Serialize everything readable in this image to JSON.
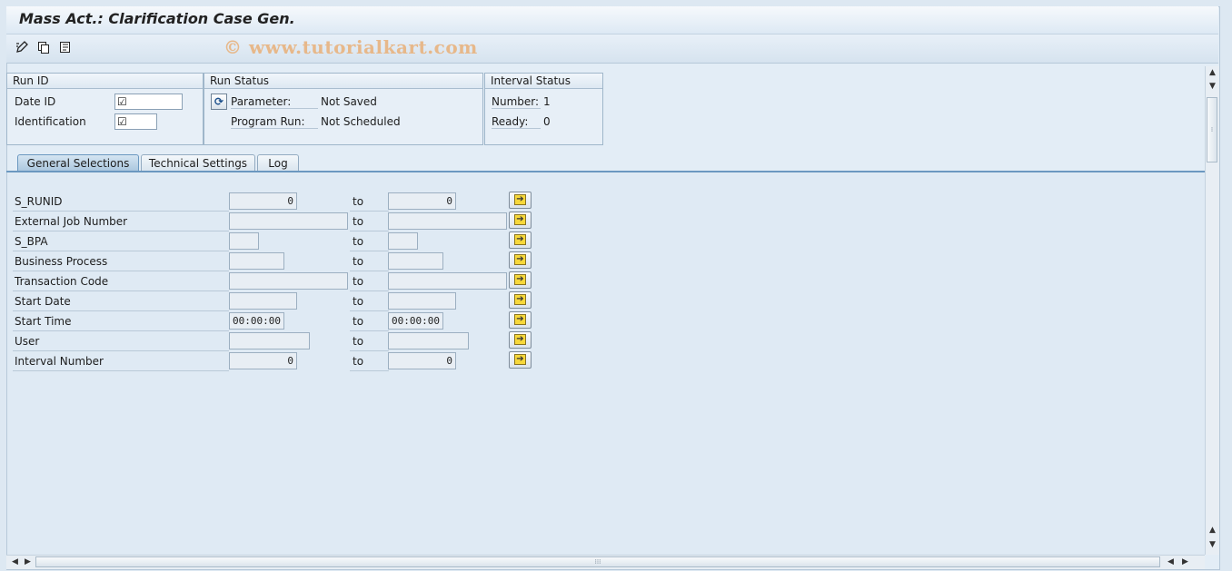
{
  "window": {
    "title": "Mass Act.: Clarification Case Gen."
  },
  "watermark": "© www.tutorialkart.com",
  "toolbar": {
    "icons": [
      "edit-pencil-icon",
      "copy-icon",
      "list-icon"
    ]
  },
  "run_id": {
    "header": "Run ID",
    "date_id_label": "Date ID",
    "identification_label": "Identification",
    "required_mark": "☑"
  },
  "run_status": {
    "header": "Run Status",
    "parameter_label": "Parameter:",
    "parameter_value": "Not Saved",
    "program_run_label": "Program Run:",
    "program_run_value": "Not Scheduled"
  },
  "interval_status": {
    "header": "Interval Status",
    "number_label": "Number:",
    "number_value": "1",
    "ready_label": "Ready:",
    "ready_value": "0"
  },
  "tabs": [
    {
      "label": "General Selections",
      "active": true
    },
    {
      "label": "Technical Settings",
      "active": false
    },
    {
      "label": "Log",
      "active": false
    }
  ],
  "selection": {
    "to_label": "to",
    "rows": [
      {
        "label": "S_RUNID",
        "from": "0",
        "to": "0"
      },
      {
        "label": "External Job Number",
        "from": "",
        "to": ""
      },
      {
        "label": "S_BPA",
        "from": "",
        "to": ""
      },
      {
        "label": "Business Process",
        "from": "",
        "to": ""
      },
      {
        "label": "Transaction Code",
        "from": "",
        "to": ""
      },
      {
        "label": "Start Date",
        "from": "",
        "to": ""
      },
      {
        "label": "Start Time",
        "from": "00:00:00",
        "to": "00:00:00"
      },
      {
        "label": "User",
        "from": "",
        "to": ""
      },
      {
        "label": "Interval Number",
        "from": "0",
        "to": "0"
      }
    ]
  },
  "colors": {
    "accent": "#6b98c0",
    "background": "#dfeaf4",
    "multi_select_arrow": "#f7d83a"
  }
}
